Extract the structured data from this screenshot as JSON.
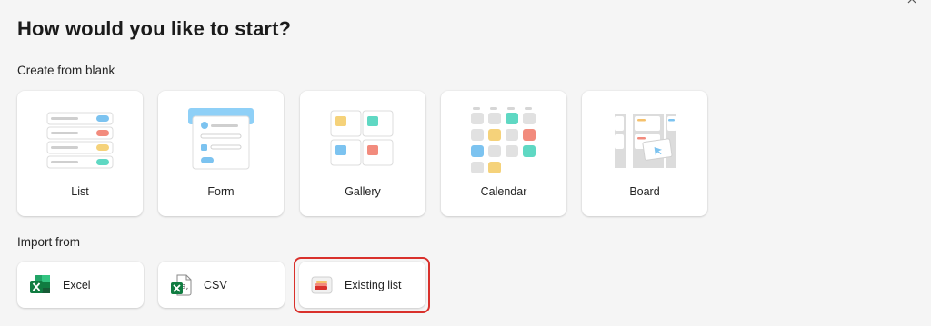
{
  "dialog": {
    "title": "How would you like to start?",
    "close_icon": "close-icon"
  },
  "create_section": {
    "label": "Create from blank",
    "options": [
      {
        "label": "List",
        "icon": "list-illustration"
      },
      {
        "label": "Form",
        "icon": "form-illustration"
      },
      {
        "label": "Gallery",
        "icon": "gallery-illustration"
      },
      {
        "label": "Calendar",
        "icon": "calendar-illustration"
      },
      {
        "label": "Board",
        "icon": "board-illustration"
      }
    ]
  },
  "import_section": {
    "label": "Import from",
    "options": [
      {
        "label": "Excel",
        "icon": "excel-icon"
      },
      {
        "label": "CSV",
        "icon": "csv-icon"
      },
      {
        "label": "Existing list",
        "icon": "existing-list-icon",
        "highlighted": true
      }
    ]
  },
  "colors": {
    "blue": "#7cc3f0",
    "red": "#f28b7d",
    "yellow": "#f5d27a",
    "teal": "#5fd8c3",
    "excel_green": "#1e7145",
    "highlight_border": "#d9312c"
  }
}
